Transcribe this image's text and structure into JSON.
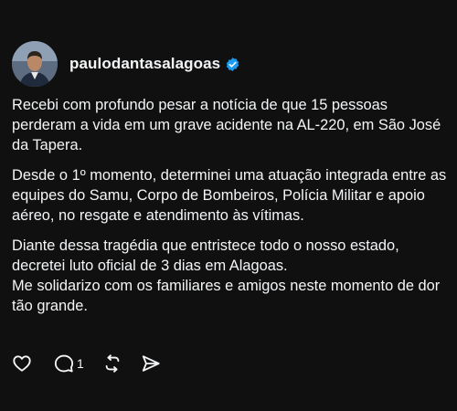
{
  "post": {
    "author": {
      "username": "paulodantasalagoas",
      "verified_icon": "verified-badge-icon",
      "badge_color": "#1d9bf0"
    },
    "paragraphs": [
      "Recebi com profundo pesar a notícia de que 15 pessoas perderam a vida em um grave acidente na AL-220, em São José da Tapera.",
      "Desde o 1º momento, determinei uma atuação integrada entre as equipes do Samu, Corpo de Bombeiros, Polícia Militar e apoio aéreo, no resgate e atendimento às vítimas.",
      "Diante dessa tragédia que entristece todo o nosso estado, decretei luto oficial de 3 dias em Alagoas.",
      "Me solidarizo com os familiares e amigos neste momento de dor tão grande."
    ],
    "actions": {
      "like_icon": "heart-icon",
      "comment_icon": "comment-icon",
      "comment_count": "1",
      "repost_icon": "repost-icon",
      "share_icon": "share-icon"
    }
  }
}
